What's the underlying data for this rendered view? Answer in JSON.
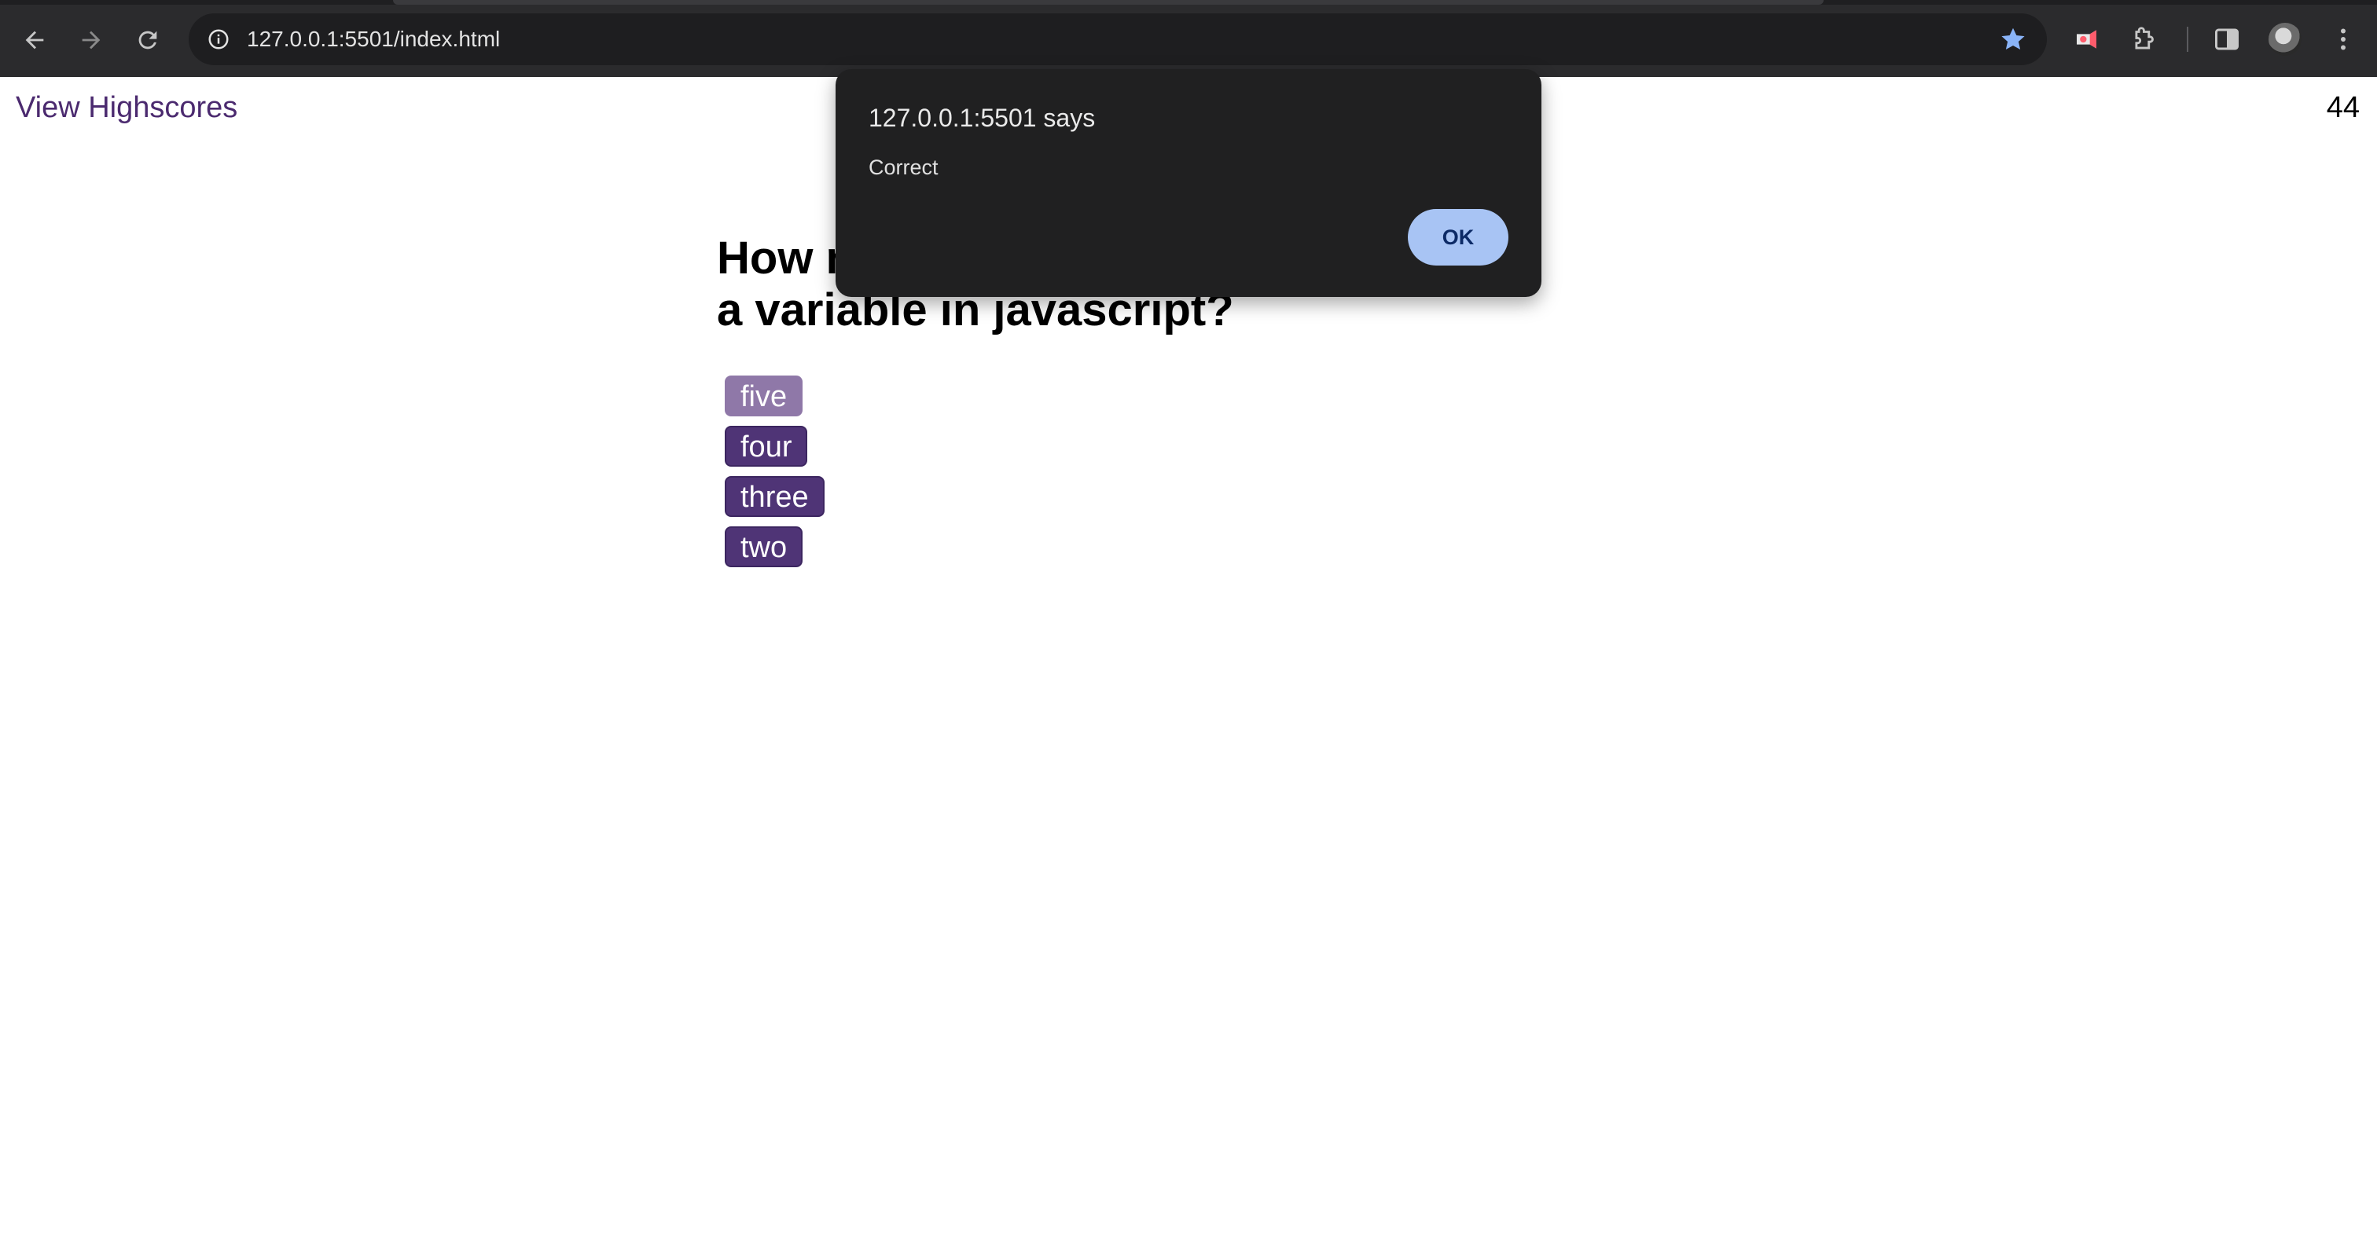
{
  "browser": {
    "url": "127.0.0.1:5501/index.html",
    "icons": [
      "back-icon",
      "forward-icon",
      "reload-icon",
      "site-info-icon",
      "bookmark-star-icon",
      "extension-record-icon",
      "extensions-puzzle-icon",
      "side-panel-icon",
      "profile-avatar-icon",
      "more-menu-icon"
    ],
    "accent_color": "#8ab4f8"
  },
  "page": {
    "highscores_link": "View Highscores",
    "timer": "44",
    "question": "How many ways to declare a variable in javascript?",
    "answers": [
      "five",
      "four",
      "three",
      "two"
    ],
    "answer_color": "#4f3476",
    "link_color": "#4b2a6f"
  },
  "dialog": {
    "title": "127.0.0.1:5501 says",
    "message": "Correct",
    "ok_label": "OK"
  }
}
